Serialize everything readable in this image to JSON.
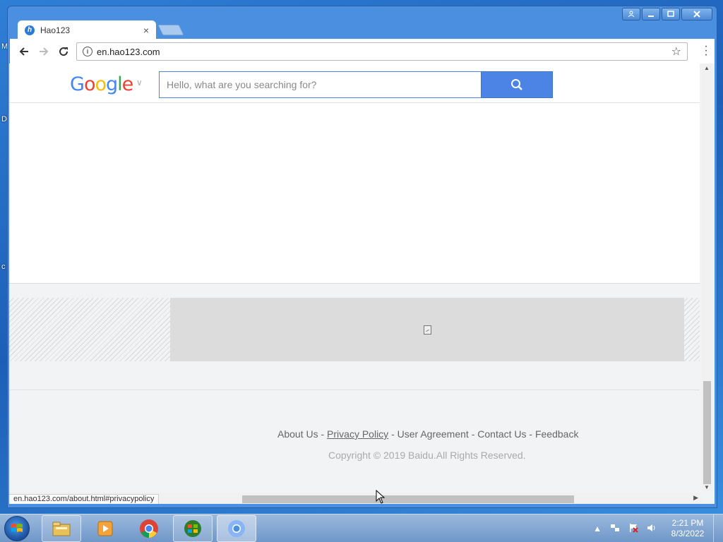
{
  "desktop": {
    "edge_letters": [
      "M",
      "D",
      "c"
    ]
  },
  "window": {
    "controls": [
      "user-icon",
      "minimize-icon",
      "maximize-icon",
      "close-icon"
    ]
  },
  "tabs": [
    {
      "title": "Hao123",
      "favicon": "h"
    }
  ],
  "toolbar": {
    "url": "en.hao123.com"
  },
  "page": {
    "search": {
      "logo": "Google",
      "placeholder": "Hello, what are you searching for?"
    },
    "footer": {
      "links": [
        "About Us",
        "Privacy Policy",
        "User Agreement",
        "Contact Us",
        "Feedback"
      ],
      "separator": " - ",
      "copyright": "Copyright © 2019 Baidu.All Rights Reserved."
    }
  },
  "status_bar": {
    "text": "en.hao123.com/about.html#privacypolicy"
  },
  "taskbar": {
    "apps": [
      "file-explorer-icon",
      "media-player-icon",
      "chrome-icon",
      "windows-live-icon",
      "chromium-icon"
    ],
    "clock": {
      "time": "2:21 PM",
      "date": "8/3/2022"
    }
  },
  "colors": {
    "search_blue": "#4b84e4",
    "window_blue": "#4a8fe0"
  }
}
